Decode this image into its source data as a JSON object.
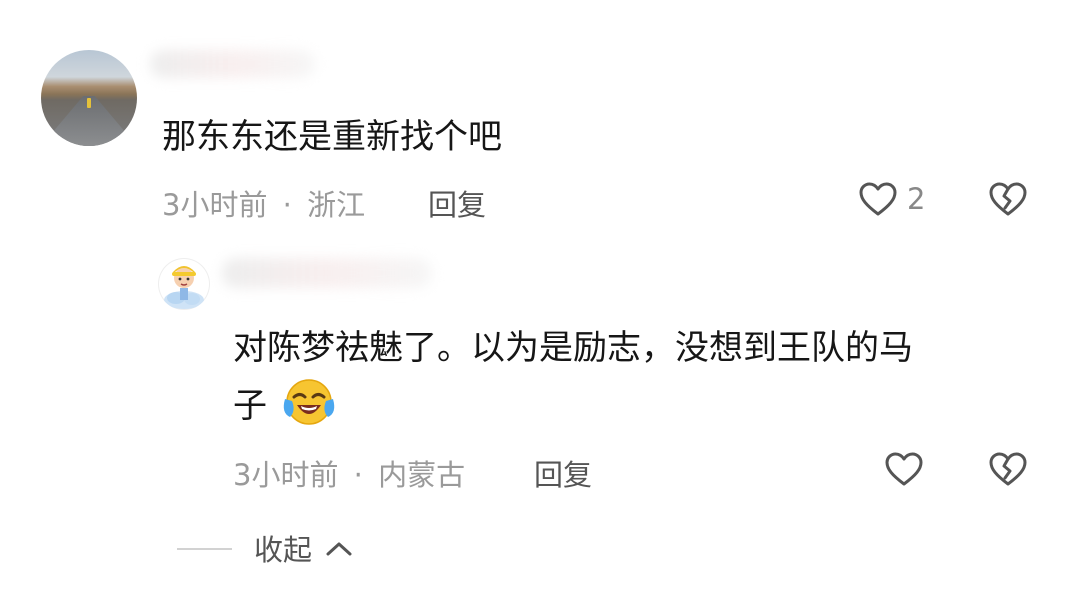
{
  "comment": {
    "text": "那东东还是重新找个吧",
    "time": "3小时前",
    "separator": "·",
    "location": "浙江",
    "reply_label": "回复",
    "like_count": "2",
    "avatar_icon": "road-landscape-avatar"
  },
  "reply_comment": {
    "text_line1": "对陈梦祛魅了。以为是励志，没想到王队的马",
    "text_line2": "子",
    "emoji_icon": "crying-laughing-emoji",
    "time": "3小时前",
    "separator": "·",
    "location": "内蒙古",
    "reply_label": "回复",
    "avatar_icon": "cartoon-boy-avatar"
  },
  "collapse": {
    "label": "收起"
  },
  "colors": {
    "text": "#161616",
    "meta": "#9a9a9a",
    "icon": "#555555"
  }
}
